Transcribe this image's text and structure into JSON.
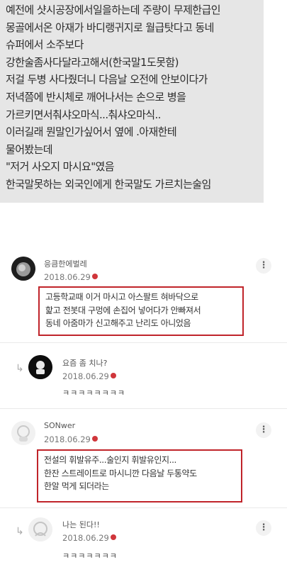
{
  "story": {
    "lines": [
      "예전에 샷시공장에서일을하는데 주량이 무제한급인",
      "몽골에서온 아재가 바디랭귀지로 월급탓다고 동네",
      "슈퍼에서 소주보다",
      "강한술좀사다달라고해서(한국말1도못함)",
      "저걸 두병 사다줬더니 다음날 오전에 안보이다가",
      "저녁쯤에 반시체로 깨어나서는 손으로 병을",
      "가르키면서춰샤오마식...춰샤오마식..",
      "이러길래 뭔말인가싶어서 옆에 .아재한테",
      "물어봤는데",
      "\"저거 사오지 마시요\"였음",
      "한국말못하는 외국인에게 한국말도 가르치는술임"
    ]
  },
  "comments": [
    {
      "nickname": "응큼한에벌레",
      "date": "2018.06.29",
      "more_label": "⋮",
      "body": [
        "고등학교때 이거 마시고 아스팔트 혀바닥으로",
        "핥고 전봇대 구멍에 손집어 넣어다가 안빠져서",
        "동네 아줌마가 신고해주고 난리도 아니었음"
      ]
    },
    {
      "nickname": "요즘 좀 치나?",
      "date": "2018.06.29",
      "more_label": "⋮",
      "body": [
        "ㅋㅋㅋㅋㅋㅋㅋㅋ"
      ],
      "reply": true
    },
    {
      "nickname": "SONwer",
      "date": "2018.06.29",
      "more_label": "⋮",
      "body": [
        "전설의 휘발유주...술인지 휘발유인지...",
        "한잔 스트레이트로 마시니깐 다음날 두통약도",
        "한알 먹게 되더라는"
      ]
    },
    {
      "nickname": "나는 된다!!",
      "date": "2018.06.29",
      "more_label": "⋮",
      "body": [
        "ㅋㅋㅋㅋㅋㅋㅋ"
      ],
      "reply": true
    }
  ],
  "colors": {
    "highlight": "#c0242a",
    "badge": "#d0363b",
    "story_bg": "#e6e6e6"
  }
}
